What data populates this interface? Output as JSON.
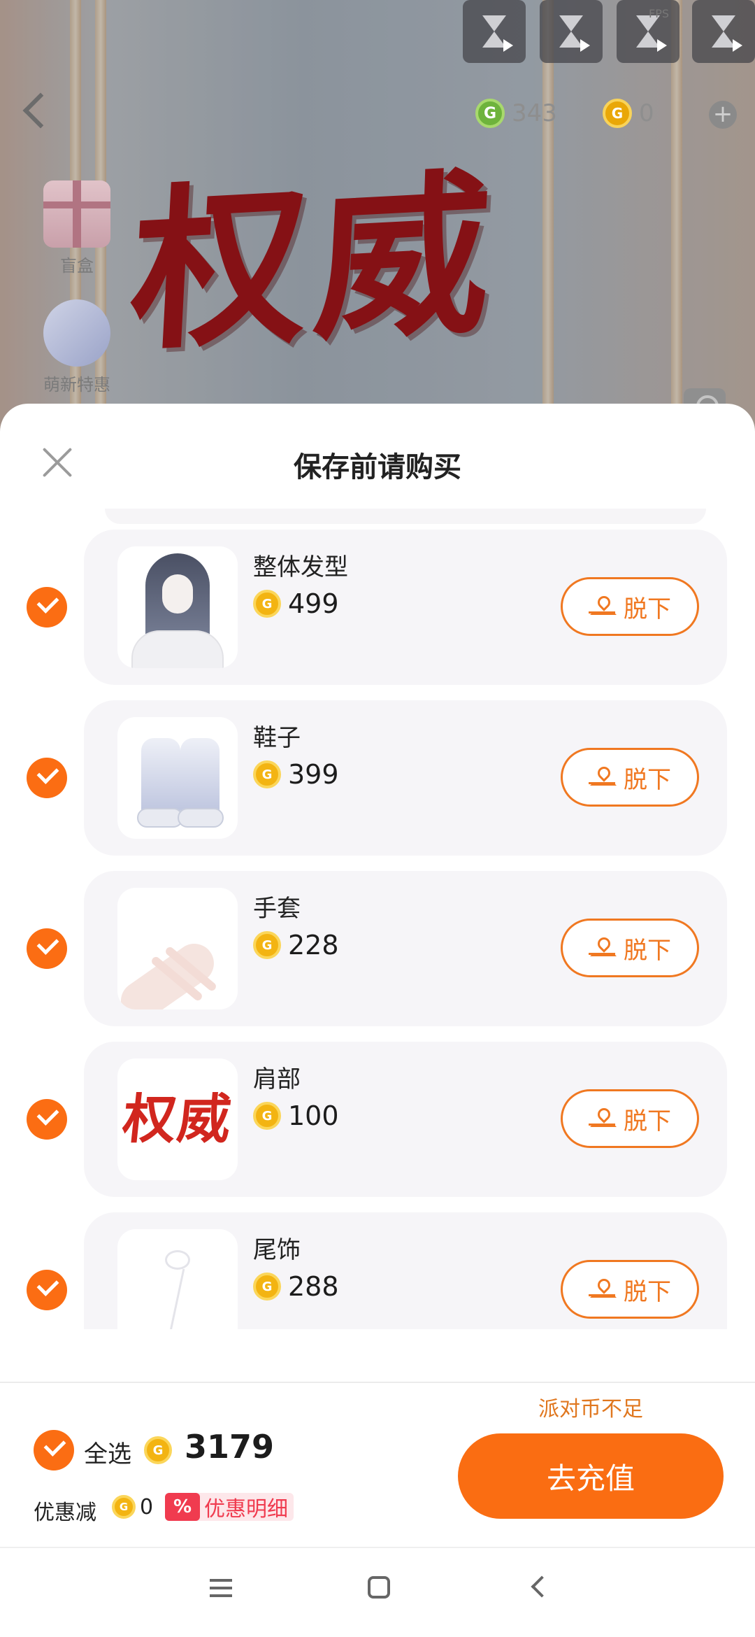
{
  "hud": {
    "fps_label": "FPS",
    "green_currency": "343",
    "gold_currency": "0",
    "plus": "+"
  },
  "side": {
    "blind_box": "盲盒",
    "newbie_offer": "萌新特惠"
  },
  "scene": {
    "overlay_text": "权威"
  },
  "sheet": {
    "title": "保存前请购买",
    "remove_label": "脱下",
    "coin_glyph": "G",
    "items": [
      {
        "name": "整体发型",
        "price": "499"
      },
      {
        "name": "鞋子",
        "price": "399"
      },
      {
        "name": "手套",
        "price": "228"
      },
      {
        "name": "肩部",
        "price": "100",
        "thumb_text": "权威"
      },
      {
        "name": "尾饰",
        "price": "288"
      }
    ]
  },
  "footer": {
    "select_all": "全选",
    "total": "3179",
    "discount_label": "优惠减",
    "discount_value": "0",
    "pct_symbol": "%",
    "discount_detail": "优惠明细",
    "insufficient": "派对币不足",
    "recharge": "去充值"
  },
  "colors": {
    "accent": "#fa6d12",
    "discount": "#f03b4f"
  }
}
